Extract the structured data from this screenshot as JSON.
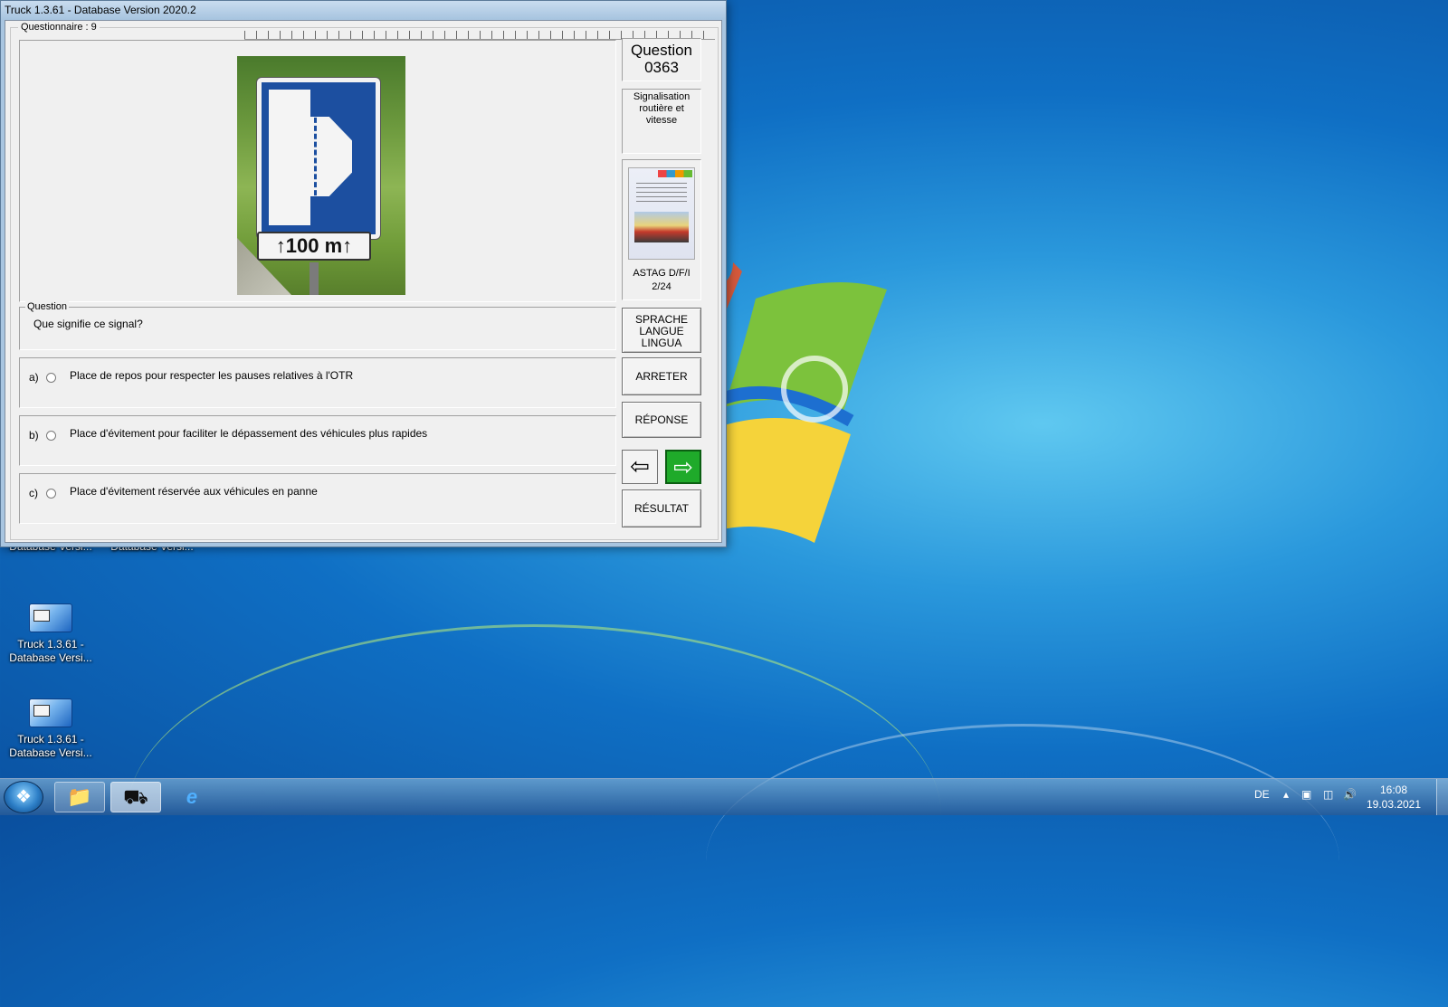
{
  "window": {
    "title": "Truck 1.3.61 - Database Version 2020.2",
    "questionnaire_label": "Questionnaire : 9"
  },
  "sign": {
    "plate_text": "↑100 m↑"
  },
  "question": {
    "number_label": "Question",
    "number": "0363",
    "category": "Signalisation routière et vitesse",
    "book_source": "ASTAG D/F/I",
    "book_page": "2/24",
    "group_label": "Question",
    "text": "Que signifie ce signal?"
  },
  "answers": [
    {
      "letter": "a)",
      "text": "Place de repos pour respecter les pauses relatives à l'OTR"
    },
    {
      "letter": "b)",
      "text": "Place d'évitement pour faciliter le dépassement des véhicules plus rapides"
    },
    {
      "letter": "c)",
      "text": "Place d'évitement réservée aux véhicules en panne"
    }
  ],
  "buttons": {
    "language": [
      "SPRACHE",
      "LANGUE",
      "LINGUA"
    ],
    "stop": "ARRETER",
    "answer": "RÉPONSE",
    "result": "RÉSULTAT",
    "prev_icon": "left-arrow-icon",
    "next_icon": "right-arrow-icon"
  },
  "desktop_icons": [
    {
      "label": "Database Versi..."
    },
    {
      "label": "Database Versi..."
    },
    {
      "label_line1": "Truck 1.3.61 -",
      "label_line2": "Database Versi..."
    },
    {
      "label_line1": "Truck 1.3.61 -",
      "label_line2": "Database Versi..."
    }
  ],
  "taskbar": {
    "language": "DE",
    "time": "16:08",
    "date": "19.03.2021",
    "apps": [
      "explorer-icon",
      "truck-app-icon",
      "internet-explorer-icon"
    ]
  },
  "colors": {
    "next_button": "#1faa2a",
    "desktop_blue": "#1a7fd0"
  }
}
